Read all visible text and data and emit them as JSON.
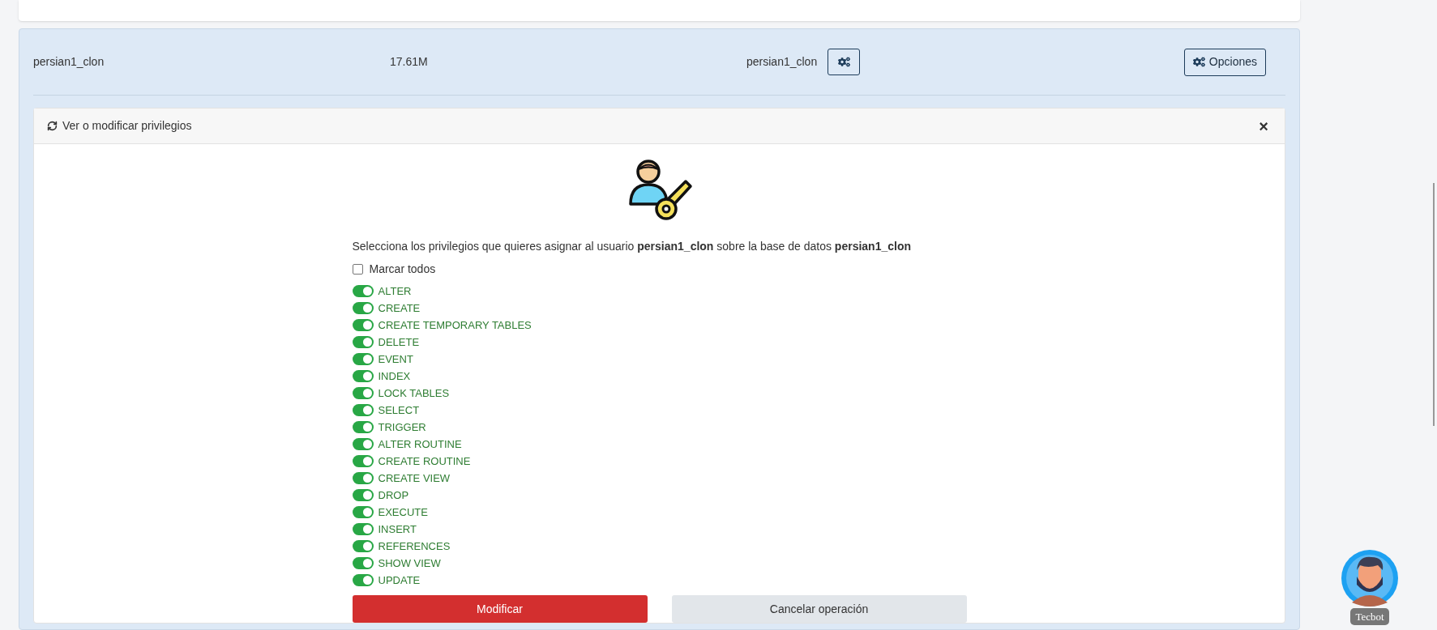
{
  "database_row": {
    "name": "persian1_clon",
    "size": "17.61M",
    "user": "persian1_clon",
    "options_button": "Opciones"
  },
  "privileges_panel": {
    "title": "Ver o modificar privilegios",
    "close": "×",
    "intro": "Selecciona los privilegios que quieres asignar al usuario **persian1_clon** sobre la base de datos **persian1_clon**",
    "select_all": {
      "label": "Marcar todos",
      "checked": false
    },
    "privileges": [
      {
        "label": "ALTER",
        "on": true
      },
      {
        "label": "CREATE",
        "on": true
      },
      {
        "label": "CREATE TEMPORARY TABLES",
        "on": true
      },
      {
        "label": "DELETE",
        "on": true
      },
      {
        "label": "EVENT",
        "on": true
      },
      {
        "label": "INDEX",
        "on": true
      },
      {
        "label": "LOCK TABLES",
        "on": true
      },
      {
        "label": "SELECT",
        "on": true
      },
      {
        "label": "TRIGGER",
        "on": true
      },
      {
        "label": "ALTER ROUTINE",
        "on": true
      },
      {
        "label": "CREATE ROUTINE",
        "on": true
      },
      {
        "label": "CREATE VIEW",
        "on": true
      },
      {
        "label": "DROP",
        "on": true
      },
      {
        "label": "EXECUTE",
        "on": true
      },
      {
        "label": "INSERT",
        "on": true
      },
      {
        "label": "REFERENCES",
        "on": true
      },
      {
        "label": "SHOW VIEW",
        "on": true
      },
      {
        "label": "UPDATE",
        "on": true
      }
    ],
    "buttons": [
      {
        "label": "Modificar",
        "kind": "primary"
      },
      {
        "label": "Cancelar operación",
        "kind": "secondary"
      }
    ]
  },
  "chatbot": {
    "label": "Tecbot"
  }
}
